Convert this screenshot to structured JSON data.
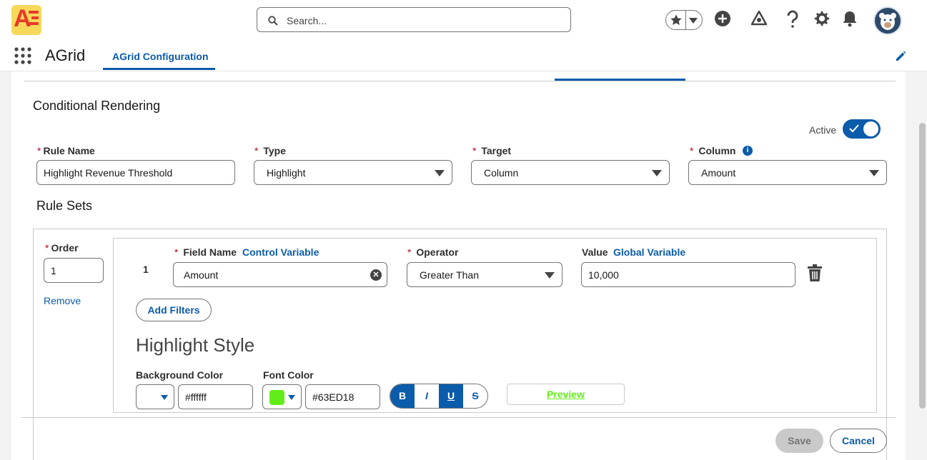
{
  "header": {
    "search_placeholder": "Search...",
    "app_name": "AGrid",
    "app_tab": "AGrid Configuration"
  },
  "section": {
    "title": "Conditional Rendering",
    "active_label": "Active",
    "active_on": true
  },
  "form": {
    "rule_name_label": "Rule Name",
    "rule_name_value": "Highlight Revenue Threshold",
    "type_label": "Type",
    "type_value": "Highlight",
    "target_label": "Target",
    "target_value": "Column",
    "column_label": "Column",
    "column_value": "Amount"
  },
  "rule_sets": {
    "title": "Rule Sets",
    "order_label": "Order",
    "order_value": "1",
    "remove_label": "Remove",
    "row_number": "1",
    "field_name_label": "Field Name",
    "control_variable_link": "Control Variable",
    "field_name_value": "Amount",
    "operator_label": "Operator",
    "operator_value": "Greater Than",
    "value_label": "Value",
    "global_variable_link": "Global Variable",
    "value_value": "10,000",
    "add_filters_label": "Add Filters"
  },
  "highlight_style": {
    "title": "Highlight Style",
    "background_color_label": "Background Color",
    "background_color_value": "#ffffff",
    "font_color_label": "Font Color",
    "font_color_value": "#63ED18",
    "bold_label": "B",
    "italic_label": "I",
    "underline_label": "U",
    "strike_label": "S",
    "preview_label": "Preview"
  },
  "footer": {
    "save_label": "Save",
    "cancel_label": "Cancel"
  },
  "colors": {
    "brand": "#0b5cab",
    "required": "#ba0517",
    "font_color": "#63ED18"
  }
}
